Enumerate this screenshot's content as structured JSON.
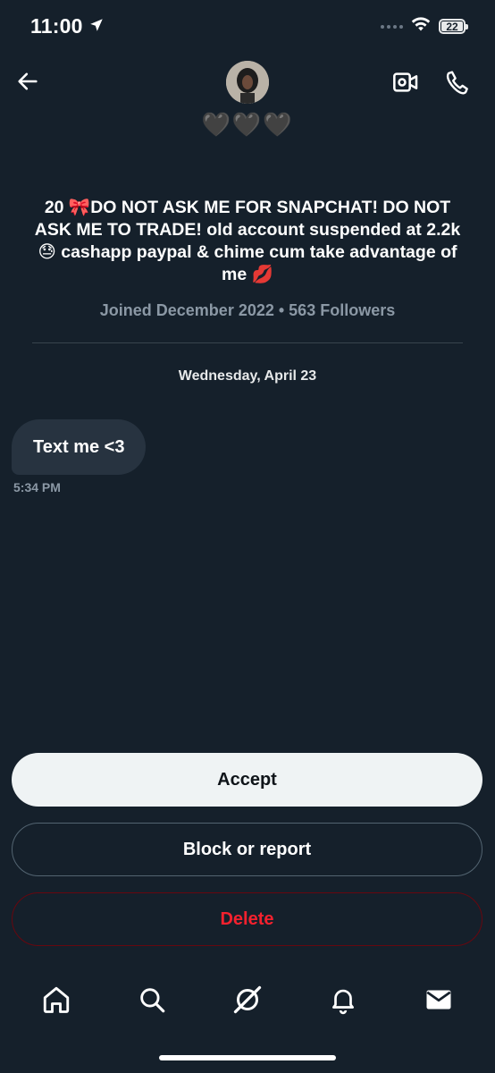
{
  "status_bar": {
    "time": "11:00",
    "battery": "22"
  },
  "header": {
    "avatar_icon": "profile-avatar",
    "hearts": "🖤🖤🖤"
  },
  "profile": {
    "bio": "20 🎀DO NOT ASK ME FOR SNAPCHAT! DO NOT ASK ME TO TRADE!  old account suspended at 2.2k 😓 cashapp paypal & chime cum take advantage of me 💋",
    "joined": "Joined December 2022 • 563 Followers"
  },
  "conversation": {
    "date_separator": "Wednesday, April 23",
    "messages": [
      {
        "text": "Text me <3",
        "time": "5:34 PM"
      }
    ]
  },
  "actions": {
    "accept_label": "Accept",
    "block_label": "Block or report",
    "delete_label": "Delete"
  },
  "colors": {
    "background": "#15202b",
    "bubble": "#273340",
    "muted_text": "#8b98a5",
    "delete_red": "#f4212e"
  },
  "nav": {
    "items": [
      "home-icon",
      "search-icon",
      "grok-icon",
      "notifications-icon",
      "messages-icon"
    ]
  }
}
